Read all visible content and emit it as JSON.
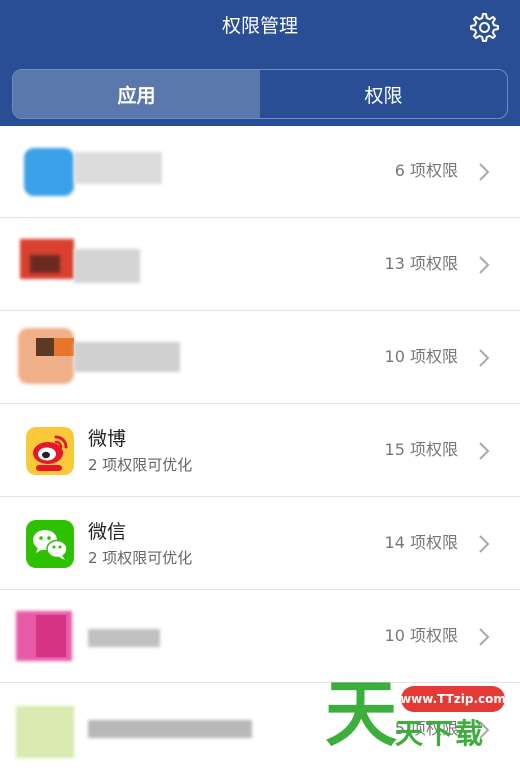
{
  "header": {
    "title": "权限管理",
    "settings_icon": "gear-icon",
    "tabs": [
      {
        "label": "应用",
        "active": true
      },
      {
        "label": "权限",
        "active": false
      }
    ]
  },
  "apps": [
    {
      "name": "",
      "subtitle": "",
      "count": "6 项权限",
      "icon": "app-icon-blurred",
      "blurred": true
    },
    {
      "name": "",
      "subtitle": "",
      "count": "13 项权限",
      "icon": "app-icon-blurred",
      "blurred": true
    },
    {
      "name": "",
      "subtitle": "",
      "count": "10 项权限",
      "icon": "app-icon-blurred",
      "blurred": true
    },
    {
      "name": "微博",
      "subtitle": "2 项权限可优化",
      "count": "15 项权限",
      "icon": "weibo-icon",
      "blurred": false
    },
    {
      "name": "微信",
      "subtitle": "2 项权限可优化",
      "count": "14 项权限",
      "icon": "wechat-icon",
      "blurred": false
    },
    {
      "name": "",
      "subtitle": "",
      "count": "10 项权限",
      "icon": "app-icon-blurred",
      "blurred": true
    },
    {
      "name": "",
      "subtitle": "",
      "count": "5 项权限",
      "icon": "app-icon-blurred",
      "blurred": true
    }
  ],
  "watermark": {
    "url": "www.TTzip.com",
    "big_char": "天",
    "rest": "天下载"
  },
  "colors": {
    "header_bg": "#2a4e95",
    "tab_active_bg": "#5b78ad",
    "weibo_bg": "#f9c93a",
    "wechat_bg": "#2dc100",
    "watermark_green": "#3cae3c",
    "watermark_red": "#e53935"
  }
}
